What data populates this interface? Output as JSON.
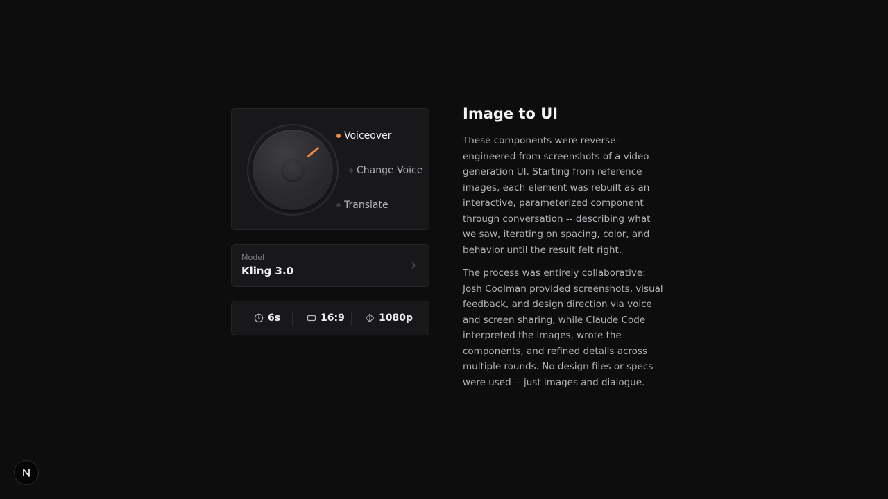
{
  "voice_panel": {
    "options": [
      {
        "label": "Voiceover",
        "active": true
      },
      {
        "label": "Change Voice",
        "active": false
      },
      {
        "label": "Translate",
        "active": false
      }
    ],
    "accent_color": "#f0883e"
  },
  "model": {
    "label": "Model",
    "value": "Kling 3.0",
    "icon": "chevron-right-icon"
  },
  "stats": {
    "duration": "6s",
    "aspect_ratio": "16:9",
    "resolution": "1080p",
    "icons": [
      "clock-icon",
      "aspect-ratio-icon",
      "diamond-icon"
    ]
  },
  "article": {
    "title": "Image to UI",
    "paragraphs": [
      "These components were reverse-engineered from screenshots of a video generation UI. Starting from reference images, each element was rebuilt as an interactive, parameterized component through conversation -- describing what we saw, iterating on spacing, color, and behavior until the result felt right.",
      "The process was entirely collaborative: Josh Coolman provided screenshots, visual feedback, and design direction via voice and screen sharing, while Claude Code interpreted the images, wrote the components, and refined details across multiple rounds. No design files or specs were used -- just images and dialogue."
    ]
  },
  "badge": {
    "letter": "N",
    "icon": "nextjs-logo-icon"
  }
}
